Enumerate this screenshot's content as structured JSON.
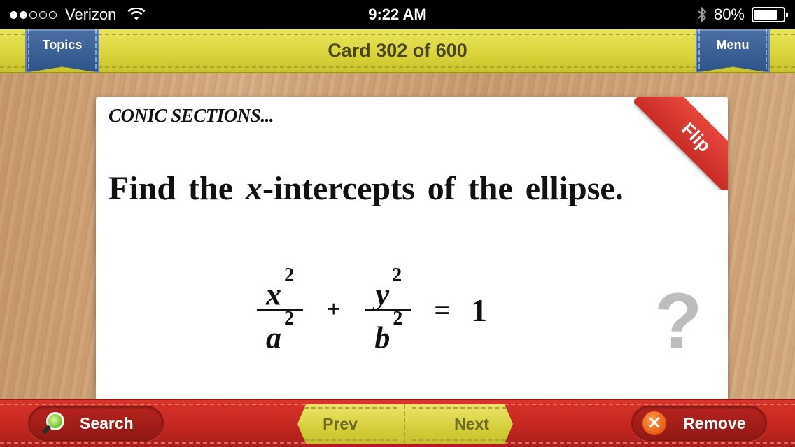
{
  "status_bar": {
    "carrier": "Verizon",
    "signal_bars_filled": 2,
    "signal_bars_total": 5,
    "time": "9:22 AM",
    "battery": "80%",
    "battery_level": 0.8
  },
  "top_bar": {
    "topics_label": "Topics",
    "title": "Card 302 of 600",
    "menu_label": "Menu"
  },
  "card": {
    "topic": "CONIC SECTIONS...",
    "question_prefix": "Find the ",
    "question_var": "x",
    "question_suffix": "-intercepts of the ellipse.",
    "formula": {
      "term1_num": "x",
      "term1_den": "a",
      "term2_num": "y",
      "term2_den": "b",
      "exponent": "2",
      "plus": "+",
      "equals": "=",
      "rhs": "1"
    },
    "flip_label": "Flip",
    "hint_symbol": "?"
  },
  "bottom_bar": {
    "search_label": "Search",
    "prev_label": "Prev",
    "next_label": "Next",
    "remove_label": "Remove",
    "remove_symbol": "×"
  },
  "colors": {
    "top_bar": "#d9d43a",
    "ribbon": "#2e5389",
    "bottom_bar": "#c22620",
    "flip_corner": "#d83a31",
    "wood": "#c89a6e"
  }
}
